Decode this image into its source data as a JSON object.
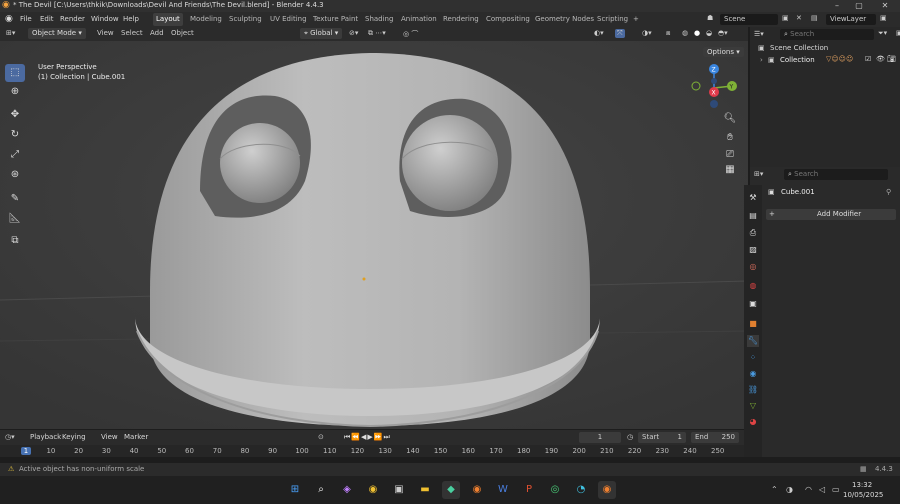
{
  "window": {
    "title": "* The Devil [C:\\Users\\thkik\\Downloads\\Devil And Friends\\The Devil.blend] - Blender 4.4.3"
  },
  "menu": [
    "File",
    "Edit",
    "Render",
    "Window",
    "Help"
  ],
  "workspaces": [
    "Layout",
    "Modeling",
    "Sculpting",
    "UV Editing",
    "Texture Paint",
    "Shading",
    "Animation",
    "Rendering",
    "Compositing",
    "Geometry Nodes",
    "Scripting"
  ],
  "active_workspace": "Layout",
  "scene": {
    "name": "Scene",
    "view_layer": "ViewLayer"
  },
  "viewport_header": {
    "mode": "Object Mode",
    "view": "View",
    "select": "Select",
    "add": "Add",
    "object": "Object",
    "orientation": "Global",
    "options": "Options"
  },
  "viewport": {
    "perspective": "User Perspective",
    "collection_info": "(1) Collection | Cube.001"
  },
  "gizmo": {
    "z": "Z",
    "y": "Y",
    "x": "X"
  },
  "outliner": {
    "search_placeholder": "Search",
    "scene_collection": "Scene Collection",
    "collection": "Collection"
  },
  "properties": {
    "search_placeholder": "Search",
    "object_name": "Cube.001",
    "add_modifier": "Add Modifier"
  },
  "timeline": {
    "playback": "Playback",
    "keying": "Keying",
    "view": "View",
    "marker": "Marker",
    "current_frame": "1",
    "start_label": "Start",
    "start": "1",
    "end_label": "End",
    "end": "250",
    "ticks": [
      "1",
      "10",
      "20",
      "30",
      "40",
      "50",
      "60",
      "70",
      "80",
      "90",
      "100",
      "110",
      "120",
      "130",
      "140",
      "150",
      "160",
      "170",
      "180",
      "190",
      "200",
      "210",
      "220",
      "230",
      "240",
      "250"
    ]
  },
  "status": {
    "message": "Active object has non-uniform scale",
    "version": "4.4.3"
  },
  "taskbar": {
    "time": "13:32",
    "date": "10/05/2025"
  },
  "colors": {
    "accent": "#4b6aa0",
    "active_frame": "#4772b3",
    "axis_x": "#e03a4a",
    "axis_y": "#7fb236",
    "axis_z": "#3a86e0"
  }
}
